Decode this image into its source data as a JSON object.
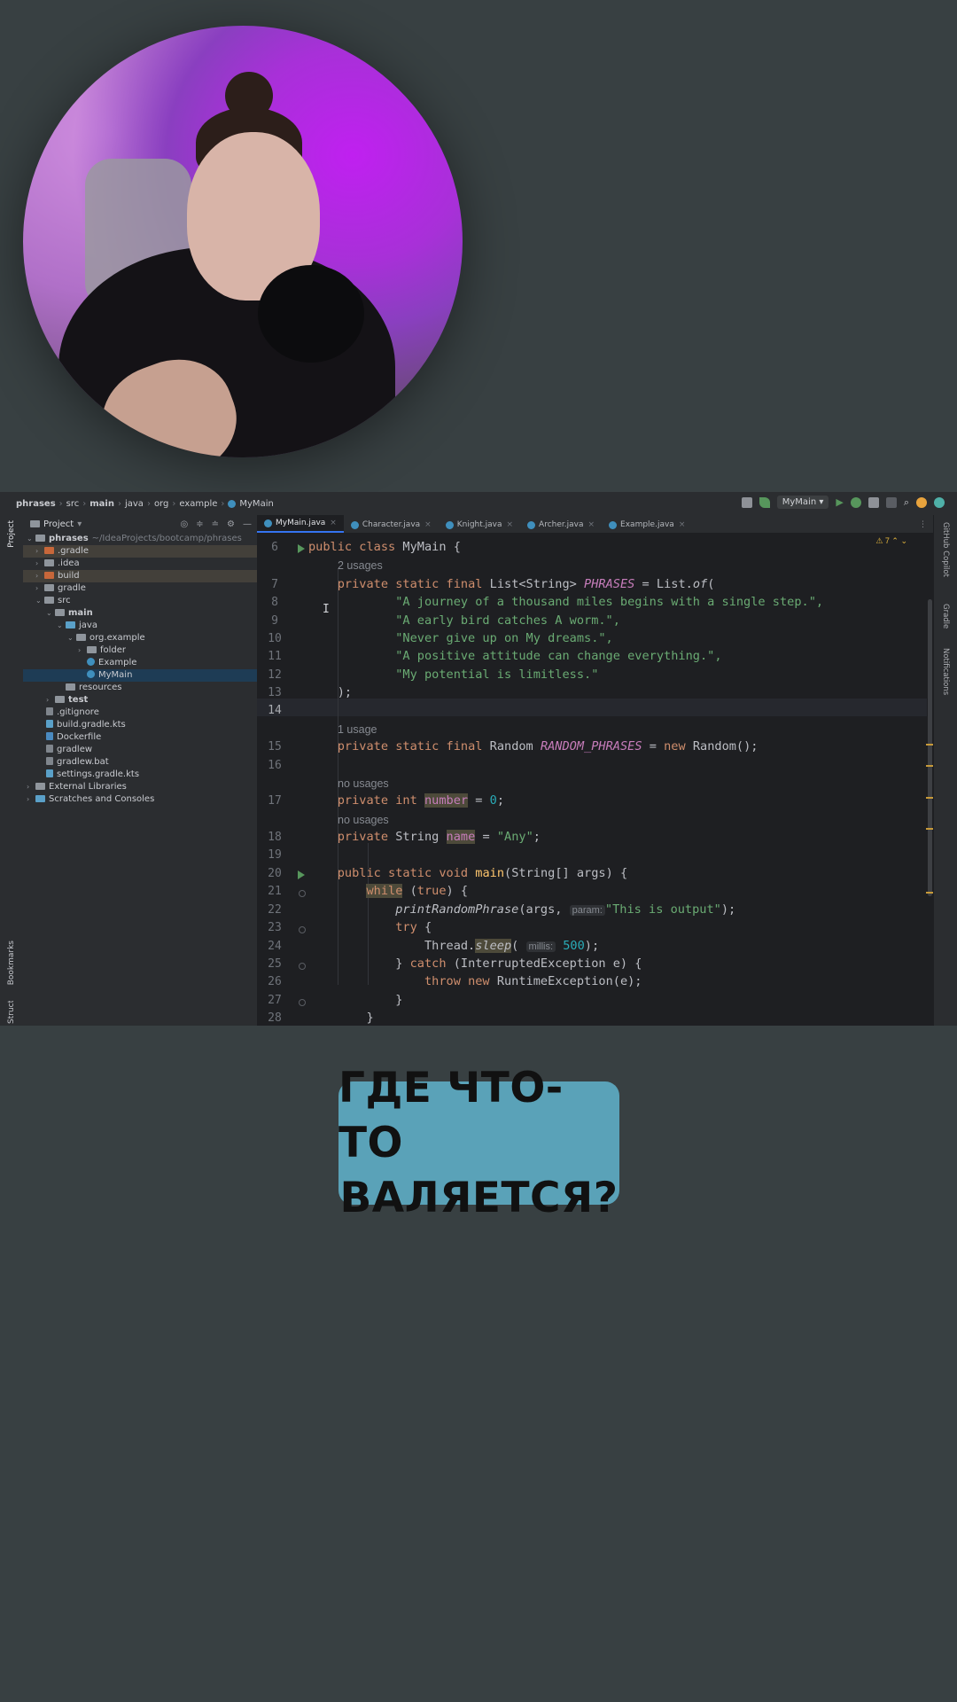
{
  "breadcrumb": [
    "phrases",
    "src",
    "main",
    "java",
    "org",
    "example",
    "MyMain"
  ],
  "toolbar": {
    "run_config": "MyMain"
  },
  "project_panel": {
    "title": "Project",
    "root_name": "phrases",
    "root_path": "~/IdeaProjects/bootcamp/phrases",
    "tree": [
      {
        "label": ".gradle"
      },
      {
        "label": ".idea"
      },
      {
        "label": "build"
      },
      {
        "label": "gradle"
      },
      {
        "label": "src"
      },
      {
        "label": "main"
      },
      {
        "label": "java"
      },
      {
        "label": "org.example"
      },
      {
        "label": "folder"
      },
      {
        "label": "Example"
      },
      {
        "label": "MyMain"
      },
      {
        "label": "resources"
      },
      {
        "label": "test"
      },
      {
        "label": ".gitignore"
      },
      {
        "label": "build.gradle.kts"
      },
      {
        "label": "Dockerfile"
      },
      {
        "label": "gradlew"
      },
      {
        "label": "gradlew.bat"
      },
      {
        "label": "settings.gradle.kts"
      },
      {
        "label": "External Libraries"
      },
      {
        "label": "Scratches and Consoles"
      }
    ]
  },
  "side_tools": {
    "left_top": "Project",
    "left_bottom": "Bookmarks",
    "left_bottom2": "Structure",
    "right_1": "GitHub Copilot",
    "right_2": "Gradle",
    "right_3": "Notifications"
  },
  "tabs": [
    "MyMain.java",
    "Character.java",
    "Knight.java",
    "Archer.java",
    "Example.java"
  ],
  "warnings": "7",
  "code": {
    "line_numbers": [
      "6",
      "7",
      "8",
      "9",
      "10",
      "11",
      "12",
      "13",
      "14",
      "15",
      "16",
      "17",
      "18",
      "19",
      "20",
      "21",
      "22",
      "23",
      "24",
      "25",
      "26",
      "27",
      "28"
    ],
    "usages": {
      "phrases": "2 usages",
      "random": "1 usage",
      "number": "no usages",
      "name": "no usages"
    },
    "hints": {
      "param": "param:",
      "millis": "millis:"
    },
    "tokens": {
      "public": "public",
      "class": "class",
      "MyMain": "MyMain",
      "brace_open": "{",
      "private": "private",
      "static": "static",
      "final": "final",
      "list_type": "List<String>",
      "PHRASES": "PHRASES",
      "eq": "=",
      "list_of_prefix": "List.",
      "of": "of",
      "paren_open": "(",
      "str1": "\"A journey of a thousand miles begins with a single step.\",",
      "str2": "\"A early bird catches A worm.\",",
      "str3": "\"Never give up on My dreams.\",",
      "str4": "\"A positive attitude can change everything.\",",
      "str5": "\"My potential is limitless.\"",
      "close_list": ");",
      "Random": "Random",
      "RANDOM_PHRASES": "RANDOM_PHRASES",
      "new": "new",
      "random_ctor": "Random();",
      "int": "int",
      "number": "number",
      "zero": "0",
      "semi": ";",
      "String": "String",
      "name": "name",
      "any": "\"Any\"",
      "void": "void",
      "main": "main",
      "main_args": "(String[] args) {",
      "while": "while",
      "true": "true",
      "while_rest": ") {",
      "printRandomPhrase": "printRandomPhrase",
      "args": "(args, ",
      "output": "\"This is output\"",
      "call_end": ");",
      "try": "try",
      "thread": "Thread.",
      "sleep": "sleep",
      "five_hundred": "500",
      "catch_open": "} ",
      "catch": "catch",
      "catch_rest": " (InterruptedException e) {",
      "throw": "throw",
      "rte": "RuntimeException(e);",
      "close": "}",
      "space_paren": " ("
    }
  },
  "caption": {
    "line1": "ГДЕ ЧТО-ТО",
    "line2": "ВАЛЯЕТСЯ?"
  },
  "colors": {
    "keyword": "#cf8e6d",
    "string": "#6aab73",
    "number": "#2aacb8",
    "static_field": "#c77dbb",
    "caption_bg": "#5aa2b8"
  }
}
